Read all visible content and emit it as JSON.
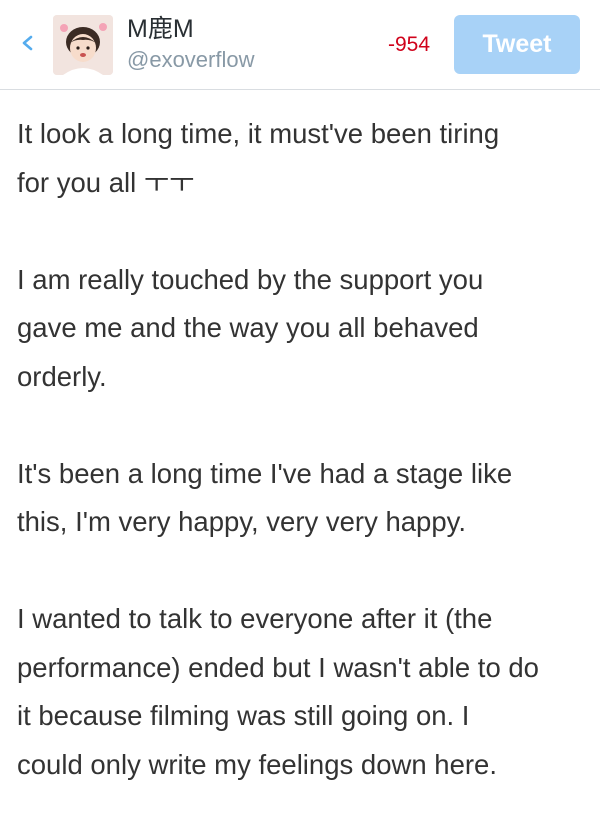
{
  "header": {
    "display_name": "M鹿M",
    "handle": "@exoverflow",
    "char_counter": "-954",
    "tweet_button_label": "Tweet",
    "back_icon": "chevron-left-icon",
    "colors": {
      "counter": "#d0021b",
      "tweet_button_bg": "#a8d2f7",
      "handle": "#8899a6",
      "back_icon": "#55acee"
    }
  },
  "compose": {
    "paragraphs": [
      {
        "lines": [
          "It look a long time, it must've been tiring",
          "for you all ㅜㅜ"
        ]
      },
      {
        "lines": [
          "I am really touched by the support you",
          "gave me and the way you all behaved",
          "orderly."
        ]
      },
      {
        "lines": [
          "It's been a long time I've had a stage like",
          "this, I'm very happy, very very happy."
        ]
      },
      {
        "lines": [
          "I wanted to talk to everyone after it (the",
          "performance) ended but I wasn't able to do",
          "it because filming was still going on. I",
          "could only write my feelings down here."
        ]
      }
    ]
  }
}
